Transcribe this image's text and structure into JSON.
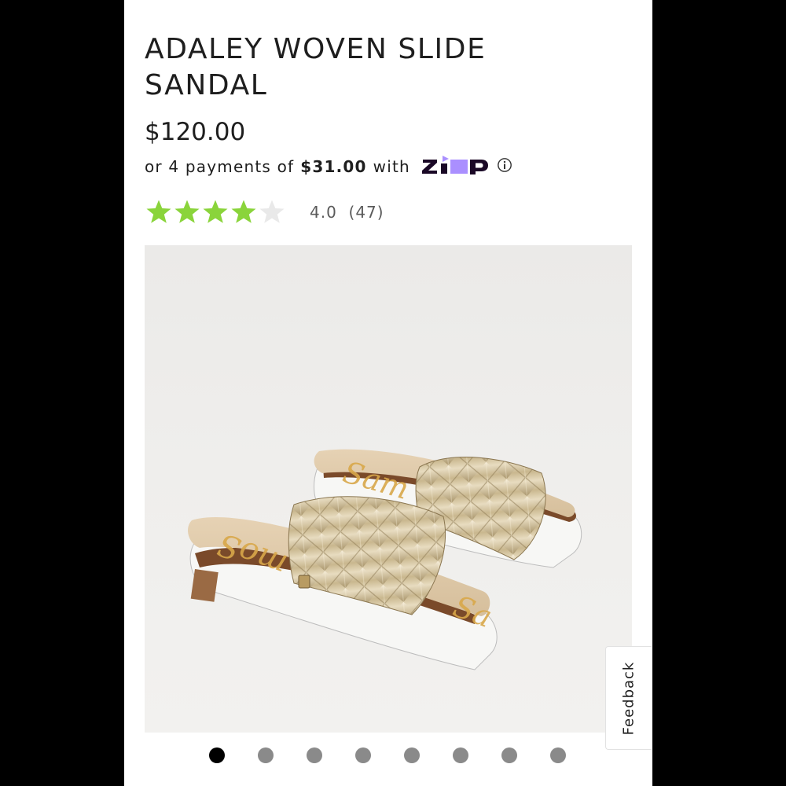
{
  "product": {
    "title": "ADALEY WOVEN SLIDE SANDAL",
    "price": "$120.00",
    "installments": {
      "prefix": "or 4 payments of",
      "amount": "$31.00",
      "suffix": "with",
      "provider_logo": "zip-logo",
      "info_icon": "info-icon"
    },
    "rating": {
      "value": 4.0,
      "max": 5,
      "text": "4.0",
      "count_text": "(47)",
      "star_color": "#8ad43b",
      "empty_star_color": "#e9e9e9"
    }
  },
  "gallery": {
    "image_alt": "gold woven slide sandals",
    "slide_count": 8,
    "active_index": 0
  },
  "feedback": {
    "label": "Feedback"
  },
  "colors": {
    "background": "#000000",
    "surface": "#ffffff",
    "text": "#1e1e1e",
    "zip_purple": "#aa8fff"
  }
}
